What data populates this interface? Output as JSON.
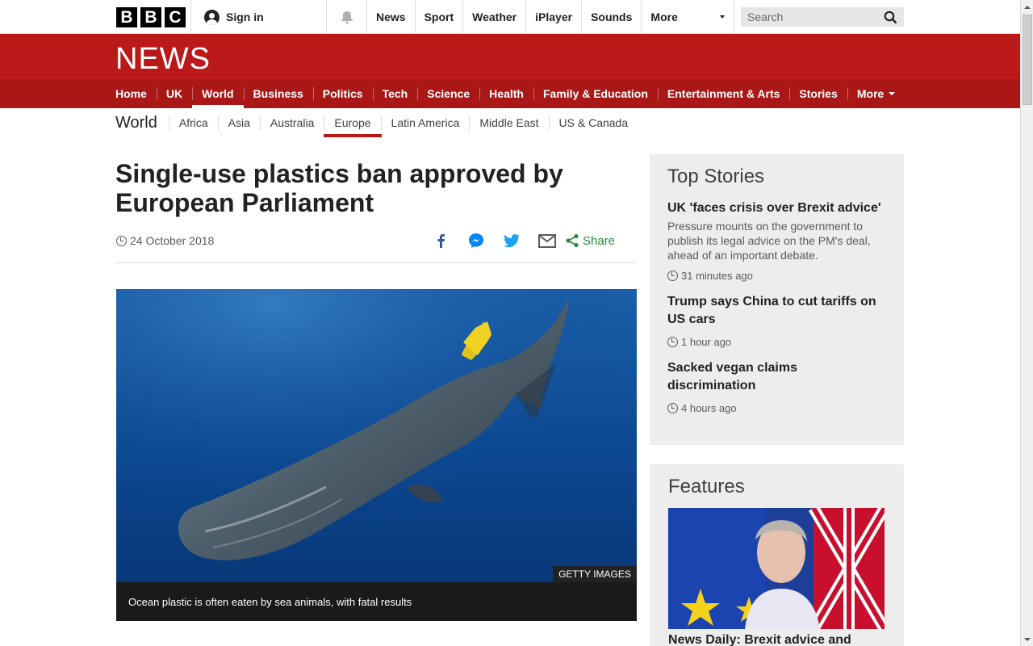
{
  "topbar": {
    "logo_letters": [
      "B",
      "B",
      "C"
    ],
    "signin_label": "Sign in",
    "nav": [
      "News",
      "Sport",
      "Weather",
      "iPlayer",
      "Sounds"
    ],
    "more_label": "More",
    "search_placeholder": "Search"
  },
  "header": {
    "title": "NEWS"
  },
  "main_nav": {
    "items": [
      "Home",
      "UK",
      "World",
      "Business",
      "Politics",
      "Tech",
      "Science",
      "Health",
      "Family & Education",
      "Entertainment & Arts",
      "Stories"
    ],
    "active": "World",
    "more_label": "More"
  },
  "sub_nav": {
    "title": "World",
    "items": [
      "Africa",
      "Asia",
      "Australia",
      "Europe",
      "Latin America",
      "Middle East",
      "US & Canada"
    ],
    "active": "Europe"
  },
  "article": {
    "headline": "Single-use plastics ban approved by European Parliament",
    "date": "24 October 2018",
    "share_label": "Share",
    "image_credit": "GETTY IMAGES",
    "image_caption": "Ocean plastic is often eaten by sea animals, with fatal results"
  },
  "top_stories": {
    "heading": "Top Stories",
    "items": [
      {
        "title": "UK 'faces crisis over Brexit advice'",
        "summary": "Pressure mounts on the government to publish its legal advice on the PM's deal, ahead of an important debate.",
        "time": "31 minutes ago"
      },
      {
        "title": "Trump says China to cut tariffs on US cars",
        "summary": "",
        "time": "1 hour ago"
      },
      {
        "title": "Sacked vegan claims discrimination",
        "summary": "",
        "time": "4 hours ago"
      }
    ]
  },
  "features": {
    "heading": "Features",
    "first_title": "News Daily: Brexit advice and"
  },
  "colors": {
    "brand_red": "#bb1919",
    "nav_red": "#a91717",
    "share_green": "#2b8a3e"
  }
}
